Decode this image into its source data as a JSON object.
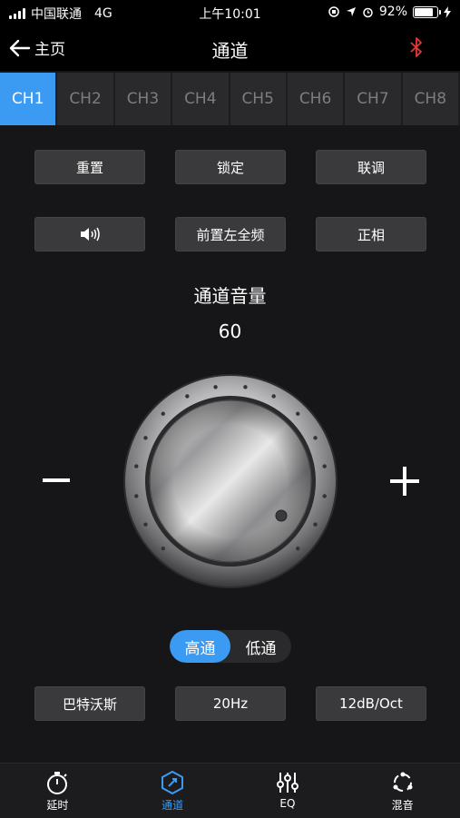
{
  "status_bar": {
    "carrier": "中国联通",
    "network": "4G",
    "time": "上午10:01",
    "battery_text": "92%",
    "battery_level": 0.92
  },
  "nav": {
    "back_label": "主页",
    "title": "通道",
    "bluetooth_icon": "bluetooth-icon",
    "bluetooth_color": "#e53935"
  },
  "channels": [
    "CH1",
    "CH2",
    "CH3",
    "CH4",
    "CH5",
    "CH6",
    "CH7",
    "CH8"
  ],
  "active_channel_index": 0,
  "controls": {
    "reset": "重置",
    "lock": "锁定",
    "link": "联调",
    "speaker_icon": "speaker-icon",
    "front_left_full": "前置左全频",
    "phase": "正相"
  },
  "volume": {
    "label": "通道音量",
    "value": "60"
  },
  "filter": {
    "high_pass": "高通",
    "low_pass": "低通",
    "selected": "高通"
  },
  "settings": {
    "filter_type": "巴特沃斯",
    "frequency": "20Hz",
    "slope": "12dB/Oct"
  },
  "bottom_nav": [
    {
      "label": "延时",
      "icon": "stopwatch-icon",
      "active": false
    },
    {
      "label": "通道",
      "icon": "channel-icon",
      "active": true
    },
    {
      "label": "EQ",
      "icon": "eq-sliders-icon",
      "active": false
    },
    {
      "label": "混音",
      "icon": "mix-icon",
      "active": false
    }
  ],
  "colors": {
    "accent": "#3b9bf2",
    "background": "#161618"
  }
}
